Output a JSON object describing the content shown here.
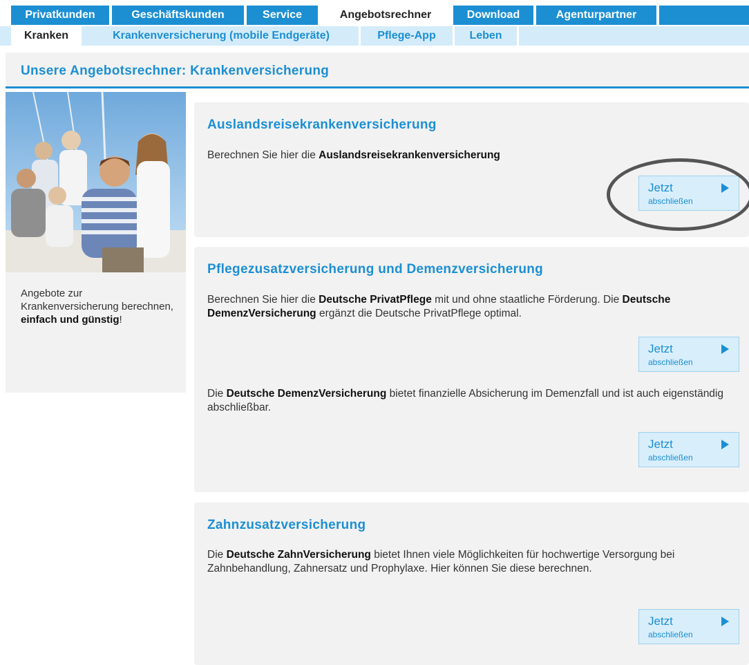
{
  "nav": {
    "tabs": [
      {
        "label": "Privatkunden",
        "active": false
      },
      {
        "label": "Geschäftskunden",
        "active": false
      },
      {
        "label": "Service",
        "active": false
      },
      {
        "label": "Angebotsrechner",
        "active": true
      },
      {
        "label": "Download",
        "active": false
      },
      {
        "label": "Agenturpartner",
        "active": false
      }
    ],
    "subtabs": [
      {
        "label": "Kranken",
        "active": true
      },
      {
        "label": "Krankenversicherung (mobile Endgeräte)",
        "active": false
      },
      {
        "label": "Pflege-App",
        "active": false
      },
      {
        "label": "Leben",
        "active": false
      }
    ]
  },
  "page": {
    "title": "Unsere Angebotsrechner: Krankenversicherung"
  },
  "sidebar": {
    "text_1": "Angebote zur Krankenversicherung berechnen, ",
    "text_bold": "einfach und günstig",
    "text_2": "!"
  },
  "cards": [
    {
      "title": "Auslandsreisekrankenversicherung",
      "p1_a": "Berechnen Sie hier die ",
      "p1_b": "Auslandsreisekrankenversicherung",
      "button": {
        "big": "Jetzt",
        "small": "abschließen"
      }
    },
    {
      "title": "Pflegezusatzversicherung und Demenzversicherung",
      "p1_a": "Berechnen Sie hier die ",
      "p1_b": "Deutsche PrivatPflege",
      "p1_c": " mit und ohne staatliche Förderung. Die ",
      "p1_d": "Deutsche DemenzVersicherung",
      "p1_e": " ergänzt die Deutsche PrivatPflege optimal.",
      "button1": {
        "big": "Jetzt",
        "small": "abschließen"
      },
      "p2_a": "Die ",
      "p2_b": "Deutsche DemenzVersicherung",
      "p2_c": " bietet finanzielle Absicherung im Demenzfall und ist auch eigenständig abschließbar.",
      "button2": {
        "big": "Jetzt",
        "small": "abschließen"
      }
    },
    {
      "title": "Zahnzusatzversicherung",
      "p1_a": "Die ",
      "p1_b": "Deutsche ZahnVersicherung",
      "p1_c": " bietet Ihnen viele Möglichkeiten für hochwertige Versorgung bei Zahnbehandlung, Zahnersatz und Prophylaxe. Hier können Sie diese berechnen.",
      "button": {
        "big": "Jetzt",
        "small": "abschließen"
      }
    }
  ],
  "colors": {
    "brand_blue": "#1c8fd3",
    "sub_nav_bg": "#d4ecfa",
    "panel_bg": "#f2f2f2",
    "button_bg": "#d8eefb"
  }
}
